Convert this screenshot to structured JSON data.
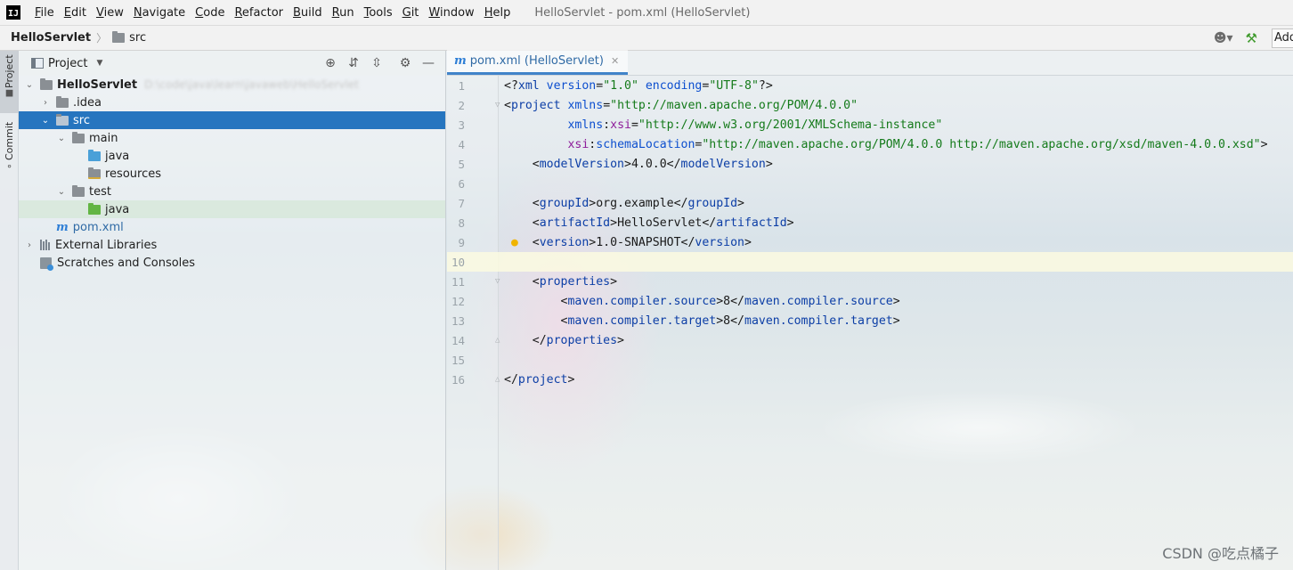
{
  "menubar": {
    "logo": "IJ",
    "items": [
      "File",
      "Edit",
      "View",
      "Navigate",
      "Code",
      "Refactor",
      "Build",
      "Run",
      "Tools",
      "Git",
      "Window",
      "Help"
    ],
    "window_title": "HelloServlet - pom.xml (HelloServlet)"
  },
  "navbar": {
    "breadcrumb_root": "HelloServlet",
    "breadcrumb_child": "src",
    "add_config_label": "Add"
  },
  "stripe": {
    "project_label": "Project",
    "commit_label": "Commit"
  },
  "project_panel": {
    "title": "Project",
    "tree": {
      "root": {
        "label": "HelloServlet",
        "path_blurred": "D:\\code\\java\\learn\\javaweb\\HelloServlet"
      },
      "idea": {
        "label": ".idea"
      },
      "src": {
        "label": "src"
      },
      "main": {
        "label": "main"
      },
      "main_java": {
        "label": "java"
      },
      "resources": {
        "label": "resources"
      },
      "test": {
        "label": "test"
      },
      "test_java": {
        "label": "java"
      },
      "pom": {
        "label": "pom.xml"
      },
      "external_libraries": {
        "label": "External Libraries"
      },
      "scratches": {
        "label": "Scratches and Consoles"
      }
    }
  },
  "editor": {
    "tab_label": "pom.xml (HelloServlet)",
    "lines": {
      "l1": {
        "n": "1",
        "p1": "<?",
        "p2": "xml ",
        "p3": "version",
        "p4": "=",
        "p5": "\"1.0\"",
        "p6": " ",
        "p7": "encoding",
        "p8": "=",
        "p9": "\"UTF-8\"",
        "p10": "?>"
      },
      "l2": {
        "n": "2",
        "p1": "<",
        "p2": "project ",
        "p3": "xmlns",
        "p4": "=",
        "p5": "\"http://maven.apache.org/POM/4.0.0\""
      },
      "l3": {
        "n": "3",
        "p1": "         ",
        "p2": "xmlns",
        "p3": ":",
        "p4": "xsi",
        "p5": "=",
        "p6": "\"http://www.w3.org/2001/XMLSchema-instance\""
      },
      "l4": {
        "n": "4",
        "p1": "         ",
        "p2": "xsi",
        "p3": ":",
        "p4": "schemaLocation",
        "p5": "=",
        "p6": "\"http://maven.apache.org/POM/4.0.0 http://maven.apache.org/xsd/maven-4.0.0.xsd\"",
        "p7": ">"
      },
      "l5": {
        "n": "5",
        "p1": "    <",
        "p2": "modelVersion",
        "p3": ">",
        "p4": "4.0.0",
        "p5": "</",
        "p6": "modelVersion",
        "p7": ">"
      },
      "l6": {
        "n": "6"
      },
      "l7": {
        "n": "7",
        "p1": "    <",
        "p2": "groupId",
        "p3": ">",
        "p4": "org.example",
        "p5": "</",
        "p6": "groupId",
        "p7": ">"
      },
      "l8": {
        "n": "8",
        "p1": "    <",
        "p2": "artifactId",
        "p3": ">",
        "p4": "HelloServlet",
        "p5": "</",
        "p6": "artifactId",
        "p7": ">"
      },
      "l9": {
        "n": "9",
        "p1": "    <",
        "p2": "version",
        "p3": ">",
        "p4": "1.0-SNAPSHOT",
        "p5": "</",
        "p6": "version",
        "p7": ">"
      },
      "l10": {
        "n": "10"
      },
      "l11": {
        "n": "11",
        "p1": "    <",
        "p2": "properties",
        "p3": ">"
      },
      "l12": {
        "n": "12",
        "p1": "        <",
        "p2": "maven.compiler.source",
        "p3": ">",
        "p4": "8",
        "p5": "</",
        "p6": "maven.compiler.source",
        "p7": ">"
      },
      "l13": {
        "n": "13",
        "p1": "        <",
        "p2": "maven.compiler.target",
        "p3": ">",
        "p4": "8",
        "p5": "</",
        "p6": "maven.compiler.target",
        "p7": ">"
      },
      "l14": {
        "n": "14",
        "p1": "    </",
        "p2": "properties",
        "p3": ">"
      },
      "l15": {
        "n": "15"
      },
      "l16": {
        "n": "16",
        "p1": "</",
        "p2": "project",
        "p3": ">"
      }
    }
  },
  "watermark": "CSDN @吃点橘子",
  "colors": {
    "selection": "#2675bf",
    "tag": "#0c3ea6",
    "attr_value": "#147a1a",
    "namespace": "#8e1e9a",
    "caret_line": "#fcfae0"
  }
}
